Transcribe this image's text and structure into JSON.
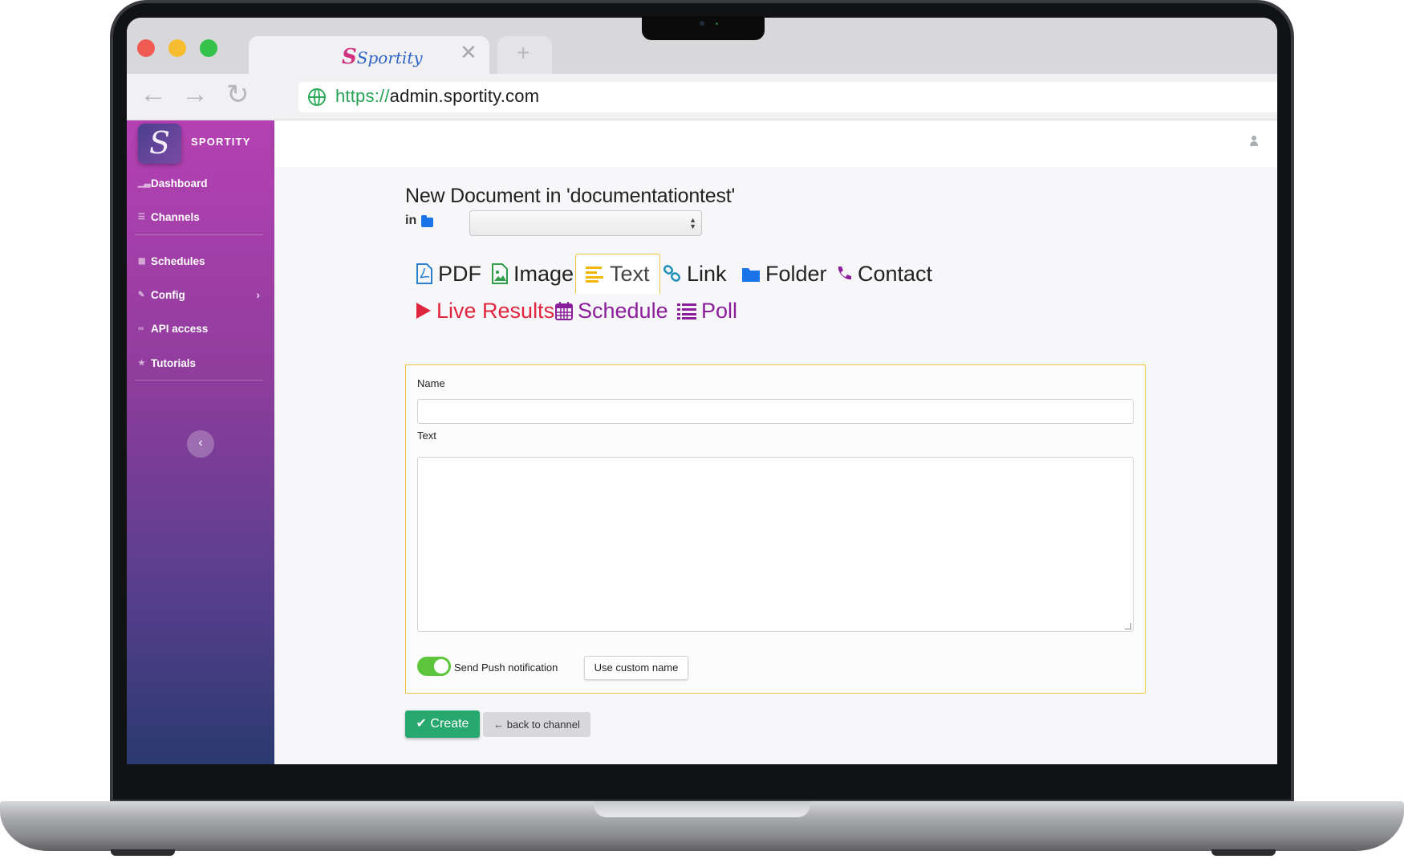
{
  "browser": {
    "tab_title": "Sportity",
    "tab_close": "✕",
    "new_tab": "+",
    "url_protocol": "https://",
    "url_host": "admin.sportity.com",
    "traffic_lights": [
      "#ef5a52",
      "#f6bd2f",
      "#34c24a"
    ]
  },
  "sidebar": {
    "brand": "SPORTITY",
    "items": [
      {
        "label": "Dashboard",
        "icon": "chart-icon"
      },
      {
        "label": "Channels",
        "icon": "list-icon"
      },
      {
        "label": "Schedules",
        "icon": "calendar-icon"
      },
      {
        "label": "Config",
        "icon": "wrench-icon"
      },
      {
        "label": "API access",
        "icon": "link-icon"
      },
      {
        "label": "Tutorials",
        "icon": "star-icon"
      }
    ]
  },
  "page": {
    "title": "New Document in 'documentationtest'",
    "in_label": "in",
    "folder_select_value": ""
  },
  "doc_types": {
    "pdf": "PDF",
    "image": "Image",
    "text": "Text",
    "link": "Link",
    "folder": "Folder",
    "contact": "Contact",
    "live_results": "Live Results",
    "schedule": "Schedule",
    "poll": "Poll",
    "active": "Text"
  },
  "form": {
    "name_label": "Name",
    "name_value": "",
    "text_label": "Text",
    "text_value": "",
    "push_label": "Send Push notification",
    "push_enabled": true,
    "custom_name_button": "Use custom name"
  },
  "actions": {
    "create": "Create",
    "back": "back to channel"
  },
  "colors": {
    "accent_yellow": "#f0c53a",
    "create_green": "#27a86e",
    "live_red": "#e0263e",
    "purple": "#8b1e9a",
    "folder_blue": "#1a73e8"
  }
}
